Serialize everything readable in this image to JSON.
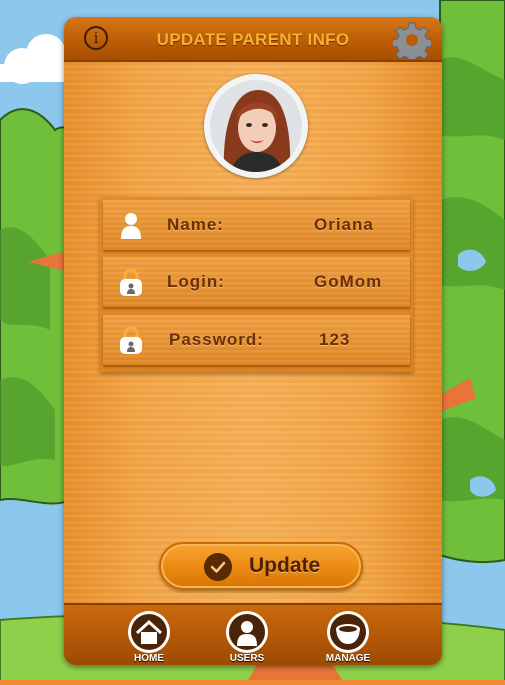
{
  "header": {
    "title": "UPDATE PARENT INFO",
    "info_icon_glyph": "i"
  },
  "profile": {
    "fields": [
      {
        "icon": "user-icon",
        "label": "Name:",
        "value": "Oriana"
      },
      {
        "icon": "lock-icon",
        "label": "Login:",
        "value": "GoMom"
      },
      {
        "icon": "lock-icon",
        "label": "Password:",
        "value": "123"
      }
    ]
  },
  "actions": {
    "update_label": "Update"
  },
  "nav": {
    "items": [
      {
        "icon": "home-icon",
        "label": "HOME"
      },
      {
        "icon": "users-icon",
        "label": "USERS"
      },
      {
        "icon": "manage-icon",
        "label": "MANAGE"
      }
    ]
  },
  "colors": {
    "title": "#f8b030",
    "panel_wood": "#f3a647",
    "topbar": "#b95c06",
    "text_brown": "#6a2f06",
    "sky": "#8cc7ec",
    "tree_green": "#6fbf3a"
  }
}
